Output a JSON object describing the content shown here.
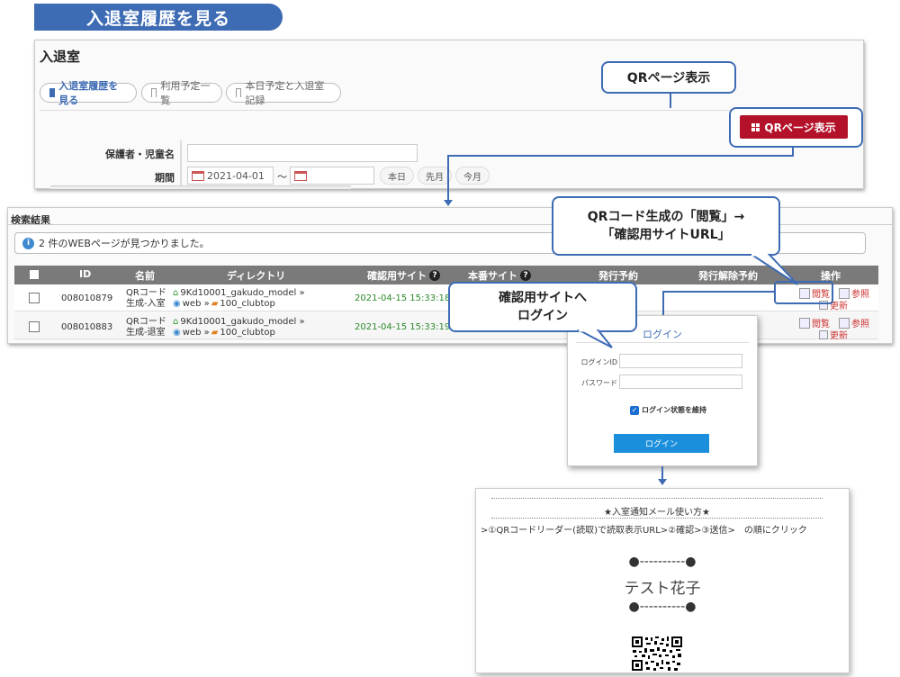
{
  "header": {
    "title": "入退室履歴を見る"
  },
  "panel1": {
    "title": "入退室",
    "tabs": [
      {
        "label": "入退室履歴を見る"
      },
      {
        "label": "利用予定一覧"
      },
      {
        "label": "本日予定と入退室記録"
      }
    ],
    "qr_button_label": "QRページ表示",
    "qr_callout": "QRページ表示",
    "form": {
      "name_label": "保護者・児童名",
      "name_value": "",
      "period_label": "期間",
      "date_from": "2021-04-01",
      "tilde": "～",
      "date_to": "",
      "btn_today": "本日",
      "btn_last_month": "先月",
      "btn_this_month": "今月"
    }
  },
  "results": {
    "title": "検索結果",
    "info_message": "2 件のWEBページが見つかりました。",
    "info_icon": "info-icon",
    "columns": [
      "ID",
      "名前",
      "ディレクトリ",
      "確認用サイト",
      "本番サイト",
      "発行予約",
      "発行解除予約",
      "操作"
    ],
    "rows": [
      {
        "id": "008010879",
        "name1": "QRコード",
        "name2": "生成-入室",
        "dir1": "9Kd10001_gakudo_model »",
        "dir2": "web » ",
        "dir3": "100_clubtop",
        "confirm_site": "2021-04-15 15:33:18",
        "view": "閲覧",
        "ref": "参照",
        "update": "更新"
      },
      {
        "id": "008010883",
        "name1": "QRコード",
        "name2": "生成-退室",
        "dir1": "9Kd10001_gakudo_model »",
        "dir2": "web » ",
        "dir3": "100_clubtop",
        "confirm_site": "2021-04-15 15:33:19",
        "view": "閲覧",
        "ref": "参照",
        "update": "更新"
      }
    ]
  },
  "callouts": {
    "view_line1": "QRコード生成の「閲覧」→",
    "view_line2": "「確認用サイトURL」",
    "login_line1": "確認用サイトへ",
    "login_line2": "ログイン"
  },
  "login": {
    "title": "ログイン",
    "id_label": "ログインID",
    "pw_label": "パスワード",
    "keep_label": "ログイン状態を維持",
    "keep_checked": true,
    "button": "ログイン"
  },
  "preview": {
    "heading": "★入室通知メール使い方★",
    "instruction": ">①QRコードリーダー(読取)で読取表示URL>②確認>③送信>　の順にクリック",
    "dashes": "●----------●",
    "name": "テスト花子"
  },
  "colors": {
    "accent": "#3d6bb4",
    "qr_button": "#b4112a",
    "login_button": "#1b8fdc"
  }
}
